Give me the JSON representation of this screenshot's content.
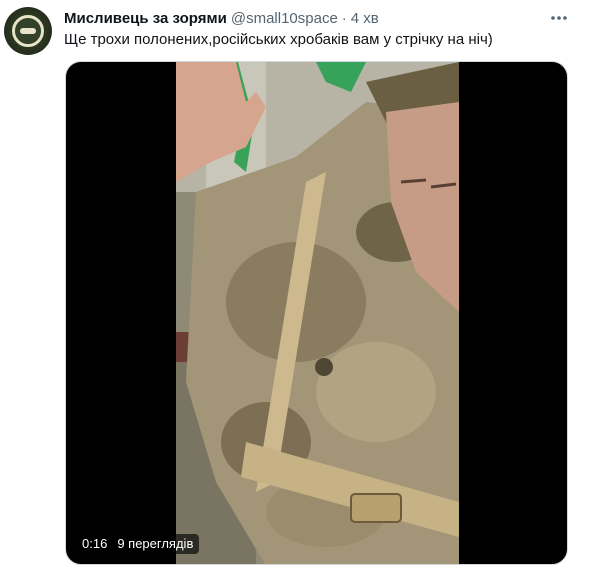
{
  "author": {
    "name": "Мисливець за зорями",
    "handle": "@small10space",
    "separator": "·",
    "time": "4 хв"
  },
  "icons": {
    "avatar": "profile-avatar",
    "more": "more-horizontal-icon"
  },
  "tweet": {
    "text": "Ще трохи полонених,російських хробаків вам у стрічку на ніч)"
  },
  "video": {
    "elapsed": "0:16",
    "views": "9 переглядів"
  },
  "colors": {
    "text_primary": "#0f1419",
    "text_secondary": "#536471",
    "media_border": "#cfd9de"
  }
}
